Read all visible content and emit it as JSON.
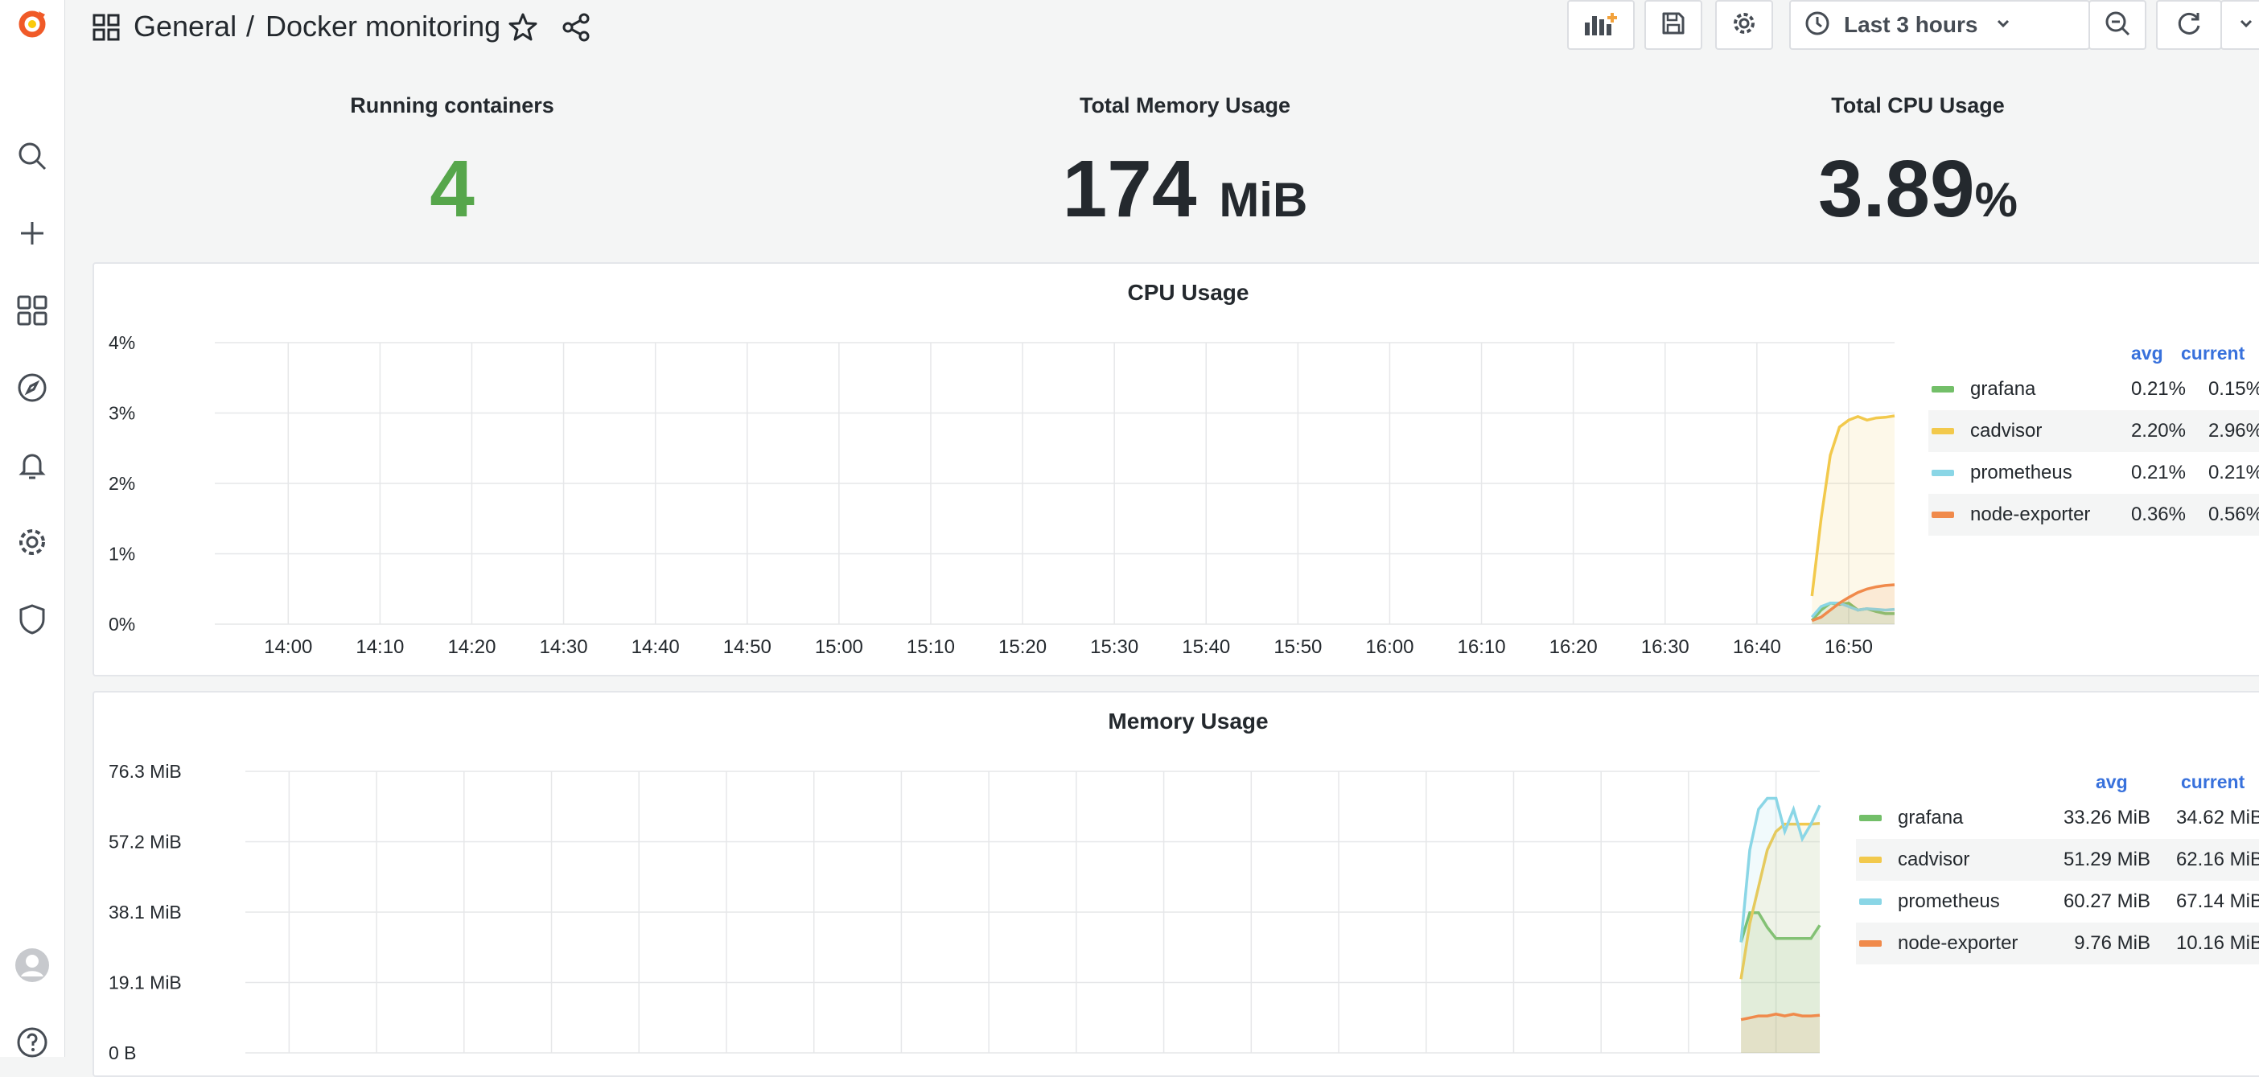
{
  "breadcrumb": {
    "folder": "General",
    "separator": "/",
    "dashboard": "Docker monitoring"
  },
  "time_picker": {
    "label": "Last 3 hours"
  },
  "stats": [
    {
      "title": "Running containers",
      "value": "4",
      "unit": "",
      "color": "#56a64b"
    },
    {
      "title": "Total Memory Usage",
      "value": "174",
      "unit": "MiB",
      "color": "#24292e"
    },
    {
      "title": "Total CPU Usage",
      "value": "3.89",
      "unit": "%",
      "color": "#24292e"
    }
  ],
  "colors": {
    "grafana": "#73bf69",
    "cadvisor": "#f2c94c",
    "prometheus": "#8ad6e6",
    "node_exporter": "#f08a4b",
    "legend_header": "#3871dc"
  },
  "cpu_panel": {
    "title": "CPU Usage",
    "legend_headers": [
      "avg",
      "current"
    ],
    "legend": [
      {
        "name": "grafana",
        "avg": "0.21%",
        "current": "0.15%"
      },
      {
        "name": "cadvisor",
        "avg": "2.20%",
        "current": "2.96%"
      },
      {
        "name": "prometheus",
        "avg": "0.21%",
        "current": "0.21%"
      },
      {
        "name": "node-exporter",
        "avg": "0.36%",
        "current": "0.56%"
      }
    ]
  },
  "mem_panel": {
    "title": "Memory Usage",
    "legend_headers": [
      "avg",
      "current"
    ],
    "legend": [
      {
        "name": "grafana",
        "avg": "33.26 MiB",
        "current": "34.62 MiB"
      },
      {
        "name": "cadvisor",
        "avg": "51.29 MiB",
        "current": "62.16 MiB"
      },
      {
        "name": "prometheus",
        "avg": "60.27 MiB",
        "current": "67.14 MiB"
      },
      {
        "name": "node-exporter",
        "avg": "9.76 MiB",
        "current": "10.16 MiB"
      }
    ]
  },
  "chart_data": [
    {
      "type": "line",
      "title": "CPU Usage",
      "xlabel": "",
      "ylabel": "",
      "x_ticks": [
        "14:00",
        "14:10",
        "14:20",
        "14:30",
        "14:40",
        "14:50",
        "15:00",
        "15:10",
        "15:20",
        "15:30",
        "15:40",
        "15:50",
        "16:00",
        "16:10",
        "16:20",
        "16:30",
        "16:40",
        "16:50"
      ],
      "y_ticks": [
        "0%",
        "1%",
        "2%",
        "3%",
        "4%"
      ],
      "ylim": [
        0,
        4
      ],
      "x_range_minutes": [
        -8,
        175
      ],
      "grid": true,
      "legend_position": "right",
      "series": [
        {
          "name": "grafana",
          "x": [
            166,
            167,
            168,
            169,
            170,
            171,
            172,
            173,
            174,
            175
          ],
          "values": [
            0.05,
            0.2,
            0.3,
            0.28,
            0.3,
            0.2,
            0.22,
            0.18,
            0.15,
            0.15
          ]
        },
        {
          "name": "cadvisor",
          "x": [
            166,
            167,
            168,
            169,
            170,
            171,
            172,
            173,
            174,
            175
          ],
          "values": [
            0.4,
            1.5,
            2.4,
            2.8,
            2.9,
            2.95,
            2.9,
            2.93,
            2.94,
            2.96
          ]
        },
        {
          "name": "prometheus",
          "x": [
            166,
            167,
            168,
            169,
            170,
            171,
            172,
            173,
            174,
            175
          ],
          "values": [
            0.1,
            0.25,
            0.3,
            0.3,
            0.25,
            0.2,
            0.22,
            0.21,
            0.2,
            0.21
          ]
        },
        {
          "name": "node-exporter",
          "x": [
            166,
            167,
            168,
            169,
            170,
            171,
            172,
            173,
            174,
            175
          ],
          "values": [
            0.05,
            0.1,
            0.2,
            0.3,
            0.38,
            0.45,
            0.5,
            0.53,
            0.55,
            0.56
          ]
        }
      ]
    },
    {
      "type": "line",
      "title": "Memory Usage",
      "xlabel": "",
      "ylabel": "",
      "y_ticks": [
        "0 B",
        "19.1 MiB",
        "38.1 MiB",
        "57.2 MiB",
        "76.3 MiB"
      ],
      "ylim": [
        0,
        76.3
      ],
      "x_range_minutes": [
        -5,
        175
      ],
      "grid": true,
      "legend_position": "right",
      "series": [
        {
          "name": "grafana",
          "x": [
            166,
            167,
            168,
            169,
            170,
            171,
            172,
            173,
            174,
            175
          ],
          "values": [
            30,
            38,
            38,
            34,
            31,
            31,
            31,
            31,
            31,
            34.6
          ]
        },
        {
          "name": "cadvisor",
          "x": [
            166,
            167,
            168,
            169,
            170,
            171,
            172,
            173,
            174,
            175
          ],
          "values": [
            20,
            35,
            45,
            55,
            60,
            62,
            62,
            62,
            62,
            62.2
          ]
        },
        {
          "name": "prometheus",
          "x": [
            166,
            167,
            168,
            169,
            170,
            171,
            172,
            173,
            174,
            175
          ],
          "values": [
            30,
            55,
            66,
            69,
            69,
            60,
            66,
            58,
            62,
            67.1
          ]
        },
        {
          "name": "node-exporter",
          "x": [
            166,
            167,
            168,
            169,
            170,
            171,
            172,
            173,
            174,
            175
          ],
          "values": [
            9,
            9.5,
            10,
            10,
            10.5,
            10,
            10.5,
            10,
            10,
            10.2
          ]
        }
      ]
    }
  ]
}
